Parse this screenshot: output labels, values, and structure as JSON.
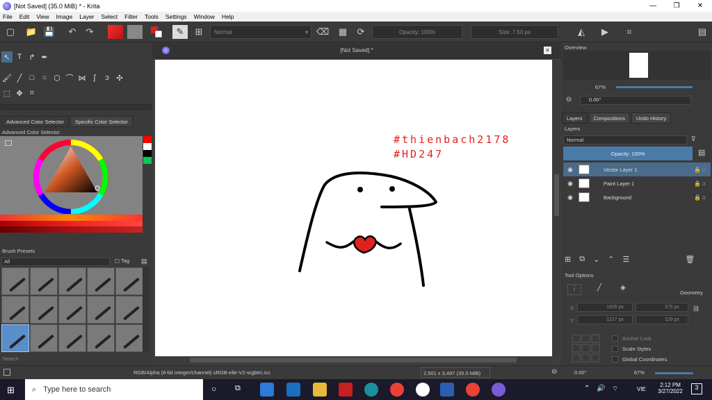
{
  "window": {
    "title": "[Not Saved]  (35.0 MiB)  * - Krita",
    "minimize_icon": "minimize-icon",
    "maximize_icon": "restore-icon",
    "close_icon": "close-icon"
  },
  "menu": [
    "File",
    "Edit",
    "View",
    "Image",
    "Layer",
    "Select",
    "Filter",
    "Tools",
    "Settings",
    "Window",
    "Help"
  ],
  "toolbar": {
    "blend_mode": "Normal",
    "opacity": "Opacity: 100%",
    "size": "Size: 7.50 px"
  },
  "colors": {
    "foreground": "#e0211e",
    "background": "#ffffff",
    "accent": "#4a7ba8"
  },
  "left": {
    "color_tabs": [
      "Advanced Color Selector",
      "Specific Color Selector"
    ],
    "color_panel_title": "Advanced Color Selector",
    "brush_presets_title": "Brush Presets",
    "brush_filter": "All",
    "tag_label": "Tag",
    "search_placeholder": "Search"
  },
  "document": {
    "tab_title": "[Not Saved]  *",
    "handwriting_line1": "#thienbach2178",
    "handwriting_line2": "#HD247"
  },
  "right": {
    "overview_title": "Overview",
    "zoom": "67%",
    "rotation": "0.00°",
    "tabs": [
      "Layers",
      "Compositions",
      "Undo History"
    ],
    "layers_title": "Layers",
    "blend_mode": "Normal",
    "opacity": "Opacity:  100%",
    "layers": [
      {
        "name": "Vector Layer 1",
        "selected": true
      },
      {
        "name": "Paint Layer 1",
        "selected": false
      },
      {
        "name": "Background",
        "selected": false
      }
    ],
    "tool_options_title": "Tool Options",
    "geometry_label": "Geometry",
    "x_label": "X:",
    "y_label": "Y:",
    "x_value": "1605 px",
    "y_value": "1227 px",
    "w_value": "375 px",
    "h_value": "129 px",
    "anchor_lock": "Anchor Lock",
    "scale_styles": "Scale Styles",
    "global_coords": "Global Coordinates"
  },
  "status": {
    "color_model": "RGB/Alpha (8-bit integer/channel)  sRGB-elle-V2-srgbtrc.icc",
    "dimensions": "2,501 x 3,497 (35.0 MiB)",
    "rotation": "0.00°",
    "zoom": "67%"
  },
  "taskbar": {
    "search_placeholder": "Type here to search",
    "language": "VIE",
    "time": "2:12 PM",
    "date": "3/27/2022",
    "notifications": "3"
  }
}
